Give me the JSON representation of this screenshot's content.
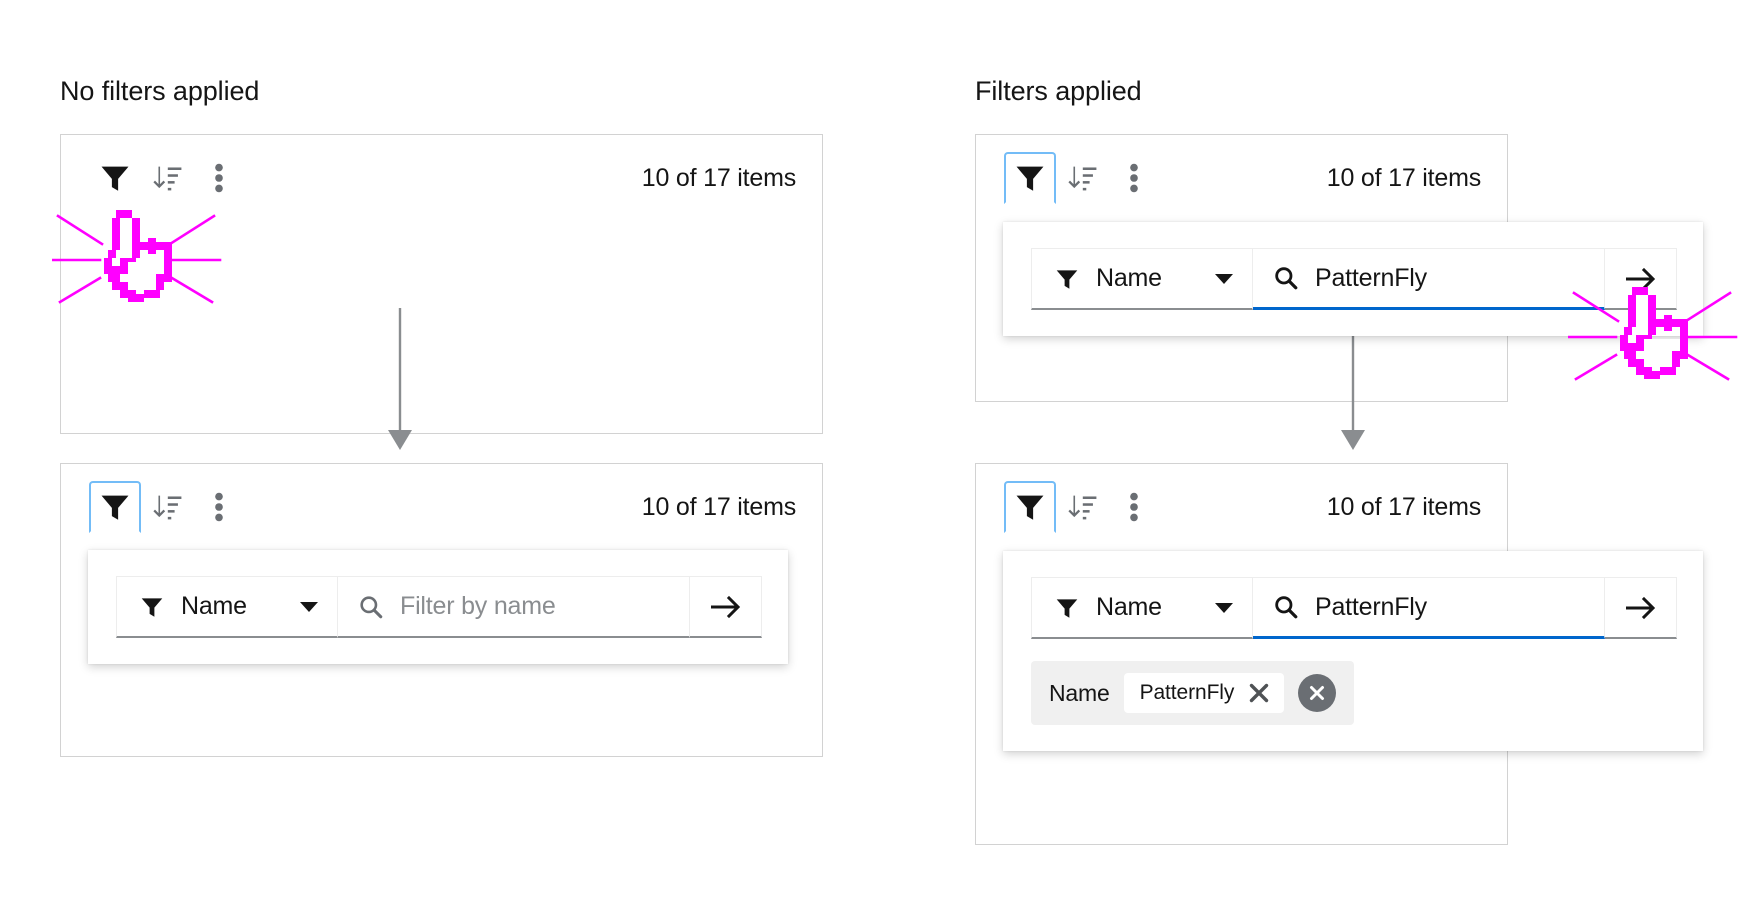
{
  "figure": {
    "columns": [
      {
        "heading": "No filters applied"
      },
      {
        "heading": "Filters applied"
      }
    ]
  },
  "icons": {
    "filter": "filter-icon",
    "sort": "sort-amount-down-icon",
    "kebab": "ellipsis-vertical-icon",
    "search": "search-icon",
    "arrow_right": "arrow-right-icon",
    "caret_down": "caret-down-icon",
    "close": "times-icon",
    "close_circle": "times-circle-icon",
    "cursor": "pointer-hand-cursor-icon",
    "flow_arrow": "flow-arrow-icon"
  },
  "colors": {
    "accent_blue": "#0066cc",
    "focus_blue": "#73bcf7",
    "cursor_magenta": "#ff00ff",
    "border_gray": "#d2d2d2",
    "icon_gray": "#6a6e73",
    "chip_bg": "#f0f0f0",
    "input_underline": "#8a8d90"
  },
  "cards": {
    "a": {
      "name": "toolbar-no-filter-collapsed",
      "toolbar": {
        "filter_button_label": "Filter",
        "sort_button_label": "Sort",
        "kebab_button_label": "More actions",
        "item_count": "10 of 17 items",
        "filter_focused": false
      }
    },
    "b": {
      "name": "toolbar-no-filter-expanded",
      "toolbar": {
        "filter_button_label": "Filter",
        "sort_button_label": "Sort",
        "kebab_button_label": "More actions",
        "item_count": "10 of 17 items",
        "filter_focused": true
      },
      "filter_panel": {
        "select_value": "Name",
        "select_options": [
          "Name"
        ],
        "input_value": "",
        "input_placeholder": "Filter by name",
        "submit_label": "Apply filter",
        "input_active": false
      }
    },
    "c": {
      "name": "toolbar-filter-typed",
      "toolbar": {
        "filter_button_label": "Filter",
        "sort_button_label": "Sort",
        "kebab_button_label": "More actions",
        "item_count": "10 of 17 items",
        "filter_focused": true
      },
      "filter_panel": {
        "select_value": "Name",
        "select_options": [
          "Name"
        ],
        "input_value": "PatternFly",
        "input_placeholder": "Filter by name",
        "submit_label": "Apply filter",
        "input_active": true
      }
    },
    "d": {
      "name": "toolbar-filter-applied",
      "toolbar": {
        "filter_button_label": "Filter",
        "sort_button_label": "Sort",
        "kebab_button_label": "More actions",
        "item_count": "10 of 17 items",
        "filter_focused": true
      },
      "filter_panel": {
        "select_value": "Name",
        "select_options": [
          "Name"
        ],
        "input_value": "PatternFly",
        "input_placeholder": "Filter by name",
        "submit_label": "Apply filter",
        "input_active": true
      },
      "chips": {
        "category_label": "Name",
        "items": [
          {
            "label": "PatternFly",
            "remove_label": "Remove filter"
          }
        ],
        "clear_all_label": "Clear all filters"
      }
    }
  }
}
